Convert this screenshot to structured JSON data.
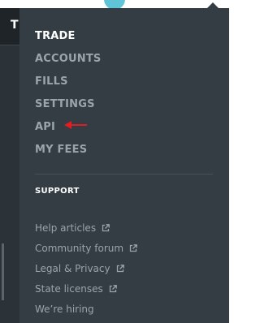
{
  "left_panel": {
    "letter": "T"
  },
  "menu": {
    "items": [
      {
        "label": "TRADE",
        "active": true
      },
      {
        "label": "ACCOUNTS",
        "active": false
      },
      {
        "label": "FILLS",
        "active": false
      },
      {
        "label": "SETTINGS",
        "active": false
      },
      {
        "label": "API",
        "active": false
      },
      {
        "label": "MY FEES",
        "active": false
      }
    ]
  },
  "support": {
    "title": "SUPPORT",
    "links": [
      {
        "label": "Help articles",
        "icon": "external-link-icon"
      },
      {
        "label": "Community forum",
        "icon": "external-link-icon"
      },
      {
        "label": "Legal & Privacy",
        "icon": "external-link-icon"
      },
      {
        "label": "State licenses",
        "icon": "external-link-icon"
      },
      {
        "label": "We’re hiring"
      }
    ]
  },
  "colors": {
    "panel_bg": "#333d43",
    "active_text": "#ffffff",
    "dim_text": "#9aa5ab",
    "annotation_arrow": "#e31b23"
  }
}
